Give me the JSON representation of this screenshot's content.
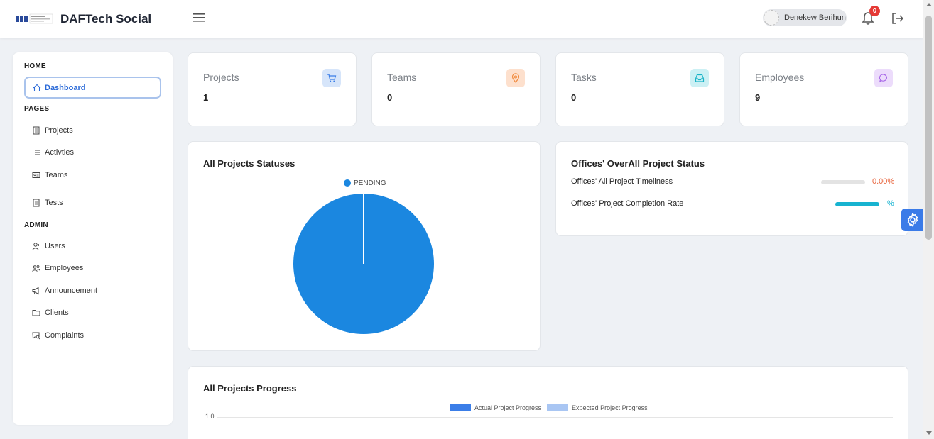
{
  "header": {
    "brand": "DAFTech Social",
    "user_name": "Denekew Berihun",
    "notification_count": "0"
  },
  "sidebar": {
    "sections": {
      "home": "HOME",
      "pages": "PAGES",
      "admin": "ADMIN"
    },
    "active_item": "Dashboard",
    "pages_items": [
      "Projects",
      "Activties",
      "Teams",
      "Tests"
    ],
    "admin_items": [
      "Users",
      "Employees",
      "Announcement",
      "Clients",
      "Complaints"
    ]
  },
  "stats": [
    {
      "label": "Projects",
      "value": "1",
      "icon": "cart-icon",
      "color": "#4e8fe0"
    },
    {
      "label": "Teams",
      "value": "0",
      "icon": "location-pin-icon",
      "color": "#f0893c"
    },
    {
      "label": "Tasks",
      "value": "0",
      "icon": "inbox-icon",
      "color": "#19b3c7"
    },
    {
      "label": "Employees",
      "value": "9",
      "icon": "chat-bubble-icon",
      "color": "#a96ae8"
    }
  ],
  "project_statuses": {
    "title": "All Projects Statuses",
    "legend": "PENDING"
  },
  "offices": {
    "title": "Offices' OverAll Project Status",
    "timeliness_label": "Offices' All Project Timeliness",
    "timeliness_value": "0.00%",
    "completion_label": "Offices' Project Completion Rate",
    "completion_value": "%"
  },
  "progress": {
    "title": "All Projects Progress",
    "legend_actual": "Actual Project Progress",
    "legend_expected": "Expected Project Progress",
    "y_tick_top": "1.0"
  },
  "chart_data": [
    {
      "type": "pie",
      "title": "All Projects Statuses",
      "categories": [
        "PENDING"
      ],
      "values": [
        1
      ],
      "colors": [
        "#1b87e0"
      ]
    },
    {
      "type": "bar",
      "title": "All Projects Progress",
      "series": [
        {
          "name": "Actual Project Progress",
          "color": "#3b7ee8",
          "values": []
        },
        {
          "name": "Expected Project Progress",
          "color": "#a9c6f3",
          "values": []
        }
      ],
      "ytick_top": 1.0
    }
  ],
  "colors": {
    "accent": "#2b6ad8",
    "timeliness_pct": "#e8643c",
    "completion_bar": "#17b3d0",
    "badge": "#e53935"
  }
}
